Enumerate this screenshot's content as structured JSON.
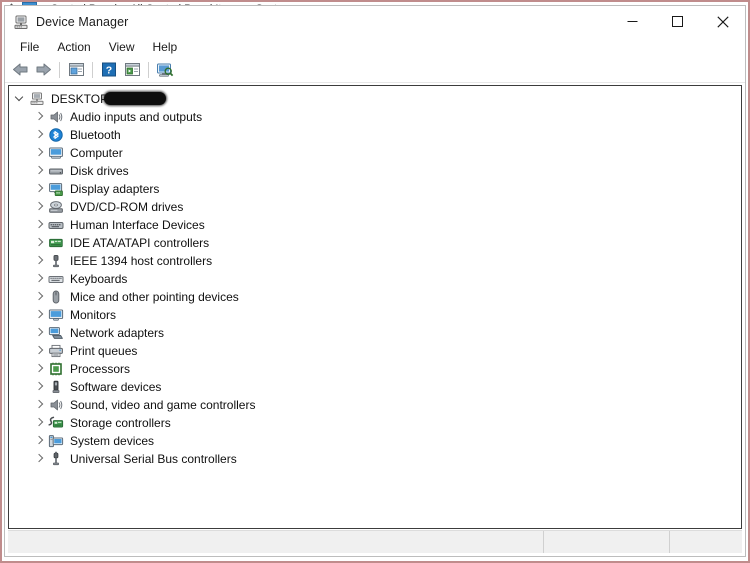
{
  "background": {
    "breadcrumb": {
      "up_icon": "up-arrow-icon",
      "check_icon": "blue-check-icon",
      "separator": "›",
      "crumbs": [
        "Control Panel",
        "All Control Panel Items",
        "System"
      ]
    }
  },
  "window": {
    "title": "Device Manager",
    "title_icon": "device-manager-icon",
    "controls": {
      "minimize": "–",
      "maximize": "□",
      "close": "✕"
    }
  },
  "menubar": {
    "items": [
      {
        "label": "File"
      },
      {
        "label": "Action"
      },
      {
        "label": "View"
      },
      {
        "label": "Help"
      }
    ]
  },
  "toolbar": {
    "buttons": [
      {
        "name": "back-icon",
        "title": "Back"
      },
      {
        "name": "forward-icon",
        "title": "Forward"
      },
      {
        "name": "separator"
      },
      {
        "name": "properties-icon",
        "title": "Properties"
      },
      {
        "name": "separator"
      },
      {
        "name": "help-icon",
        "title": "Help"
      },
      {
        "name": "show-hidden-devices-icon",
        "title": "Show hidden devices"
      },
      {
        "name": "separator"
      },
      {
        "name": "scan-for-hardware-changes-icon",
        "title": "Scan for hardware changes"
      }
    ]
  },
  "tree": {
    "root": {
      "label": "DESKTOP",
      "icon": "computer-root-icon",
      "expanded": true,
      "redacted": true
    },
    "nodes": [
      {
        "label": "Audio inputs and outputs",
        "icon": "speaker-icon"
      },
      {
        "label": "Bluetooth",
        "icon": "bluetooth-icon"
      },
      {
        "label": "Computer",
        "icon": "computer-icon"
      },
      {
        "label": "Disk drives",
        "icon": "disk-drive-icon"
      },
      {
        "label": "Display adapters",
        "icon": "display-adapter-icon"
      },
      {
        "label": "DVD/CD-ROM drives",
        "icon": "optical-drive-icon"
      },
      {
        "label": "Human Interface Devices",
        "icon": "hid-icon"
      },
      {
        "label": "IDE ATA/ATAPI controllers",
        "icon": "ide-controller-icon"
      },
      {
        "label": "IEEE 1394 host controllers",
        "icon": "ieee1394-icon"
      },
      {
        "label": "Keyboards",
        "icon": "keyboard-icon"
      },
      {
        "label": "Mice and other pointing devices",
        "icon": "mouse-icon"
      },
      {
        "label": "Monitors",
        "icon": "monitor-icon"
      },
      {
        "label": "Network adapters",
        "icon": "network-adapter-icon"
      },
      {
        "label": "Print queues",
        "icon": "printer-icon"
      },
      {
        "label": "Processors",
        "icon": "processor-icon"
      },
      {
        "label": "Software devices",
        "icon": "software-device-icon"
      },
      {
        "label": "Sound, video and game controllers",
        "icon": "sound-controller-icon"
      },
      {
        "label": "Storage controllers",
        "icon": "storage-controller-icon"
      },
      {
        "label": "System devices",
        "icon": "system-device-icon"
      },
      {
        "label": "Universal Serial Bus controllers",
        "icon": "usb-controller-icon"
      }
    ]
  },
  "statusbar": {
    "main": "",
    "middle": "",
    "end": ""
  },
  "colors": {
    "window_border": "#bdbdbd",
    "outer_border": "#c08c8c",
    "accent_blue": "#3d8fd1",
    "status_bg": "#f0f0f0"
  }
}
